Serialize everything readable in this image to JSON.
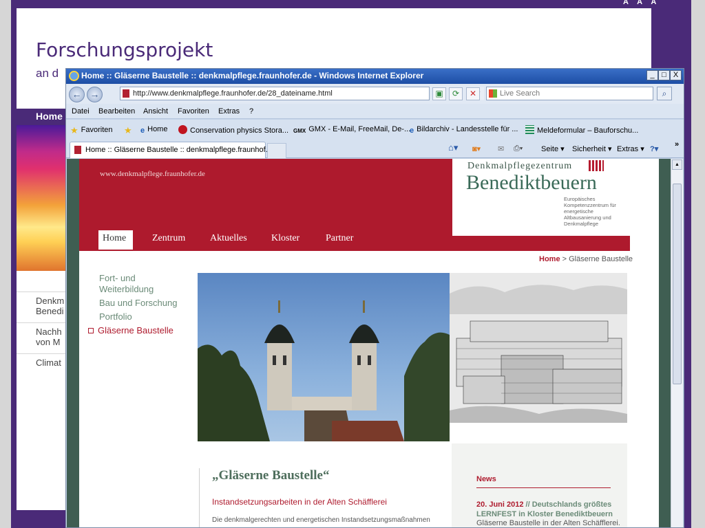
{
  "outer": {
    "aaa": "A A A",
    "title": "Forschungsprojekt",
    "subtitle": "an d",
    "nav_home": "Home",
    "list": [
      "Denkm Benedi",
      "Nachh von M",
      "Climat"
    ]
  },
  "ie": {
    "window_title": "Home :: Gläserne Baustelle :: denkmalpflege.fraunhofer.de - Windows Internet Explorer",
    "window_buttons": [
      "_",
      "□",
      "X"
    ],
    "url": "http://www.denkmalpflege.fraunhofer.de/28_dateiname.html",
    "search_placeholder": "Live Search",
    "menu": [
      "Datei",
      "Bearbeiten",
      "Ansicht",
      "Favoriten",
      "Extras",
      "?"
    ],
    "favorites_label": "Favoriten",
    "favorites": [
      "Home",
      "Conservation physics Stora...",
      "GMX - E-Mail, FreeMail, De-...",
      "Bildarchiv - Landesstelle für ...",
      "Meldeformular – Bauforschu..."
    ],
    "tab_label": "Home :: Gläserne Baustelle :: denkmalpflege.fraunhof...",
    "commands": [
      "Seite ▾",
      "Sicherheit ▾",
      "Extras ▾"
    ],
    "overflow": "»"
  },
  "site": {
    "url_text": "www.denkmalpflege.fraunhofer.de",
    "logo_sup": "Denkmalpflegezentrum",
    "logo_main": "Benediktbeuern",
    "logo_small": "Europäisches Kompetenzzentrum für energetische Altbausanierung und Denkmalpflege",
    "nav": [
      "Home",
      "Zentrum",
      "Aktuelles",
      "Kloster",
      "Partner"
    ],
    "breadcrumb_home": "Home",
    "breadcrumb_rest": " > Gläserne Baustelle",
    "side_links": [
      "Fort- und Weiterbildung",
      "Bau und Forschung",
      "Portfolio",
      "Gläserne Baustelle"
    ],
    "main_title": "„Gläserne Baustelle“",
    "main_subtitle": "Instandsetzungsarbeiten in der Alten Schäfflerei",
    "main_text": "Die denkmalgerechten und energetischen Instandsetzungsmaßnahmen",
    "news_title": "News",
    "news_date": "20. Juni 2012",
    "news_headline": " // Deutschlands größtes LERNFEST in Kloster Benediktbeuern",
    "news_desc": "Gläserne Baustelle in der Alten Schäfflerei."
  },
  "colors": {
    "purple": "#4a2a78",
    "crimson": "#ae1a2d",
    "green_text": "#4e6e5c"
  }
}
